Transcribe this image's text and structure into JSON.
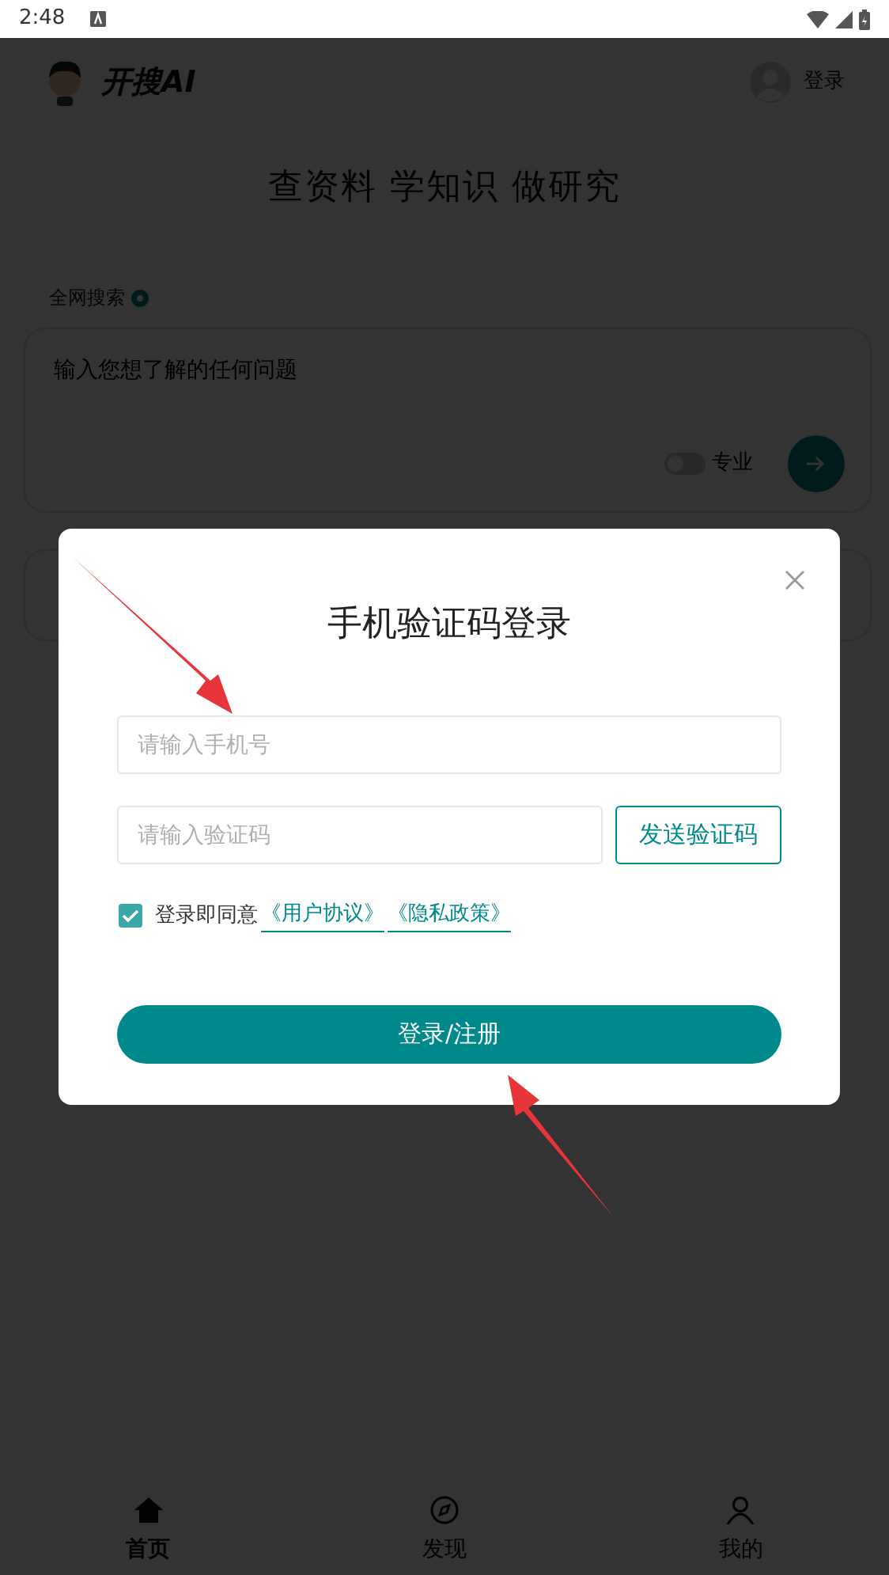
{
  "status_bar": {
    "time": "2:48"
  },
  "header": {
    "app_name": "开搜AI",
    "login": "登录"
  },
  "tagline": "查资料 学知识 做研究",
  "search": {
    "label": "全网搜索",
    "placeholder": "输入您想了解的任何问题",
    "pro_toggle": {
      "label": "专业",
      "on": false
    }
  },
  "bottom_nav": [
    {
      "label": "首页",
      "selected": true
    },
    {
      "label": "发现",
      "selected": false
    },
    {
      "label": "我的",
      "selected": false
    }
  ],
  "dialog": {
    "title": "手机验证码登录",
    "phone_placeholder": "请输入手机号",
    "code_placeholder": "请输入验证码",
    "send_code": "发送验证码",
    "agreement": {
      "checked": true,
      "text": "登录即同意",
      "links": [
        "《用户协议》",
        "《隐私政策》"
      ]
    },
    "submit": "登录/注册"
  }
}
